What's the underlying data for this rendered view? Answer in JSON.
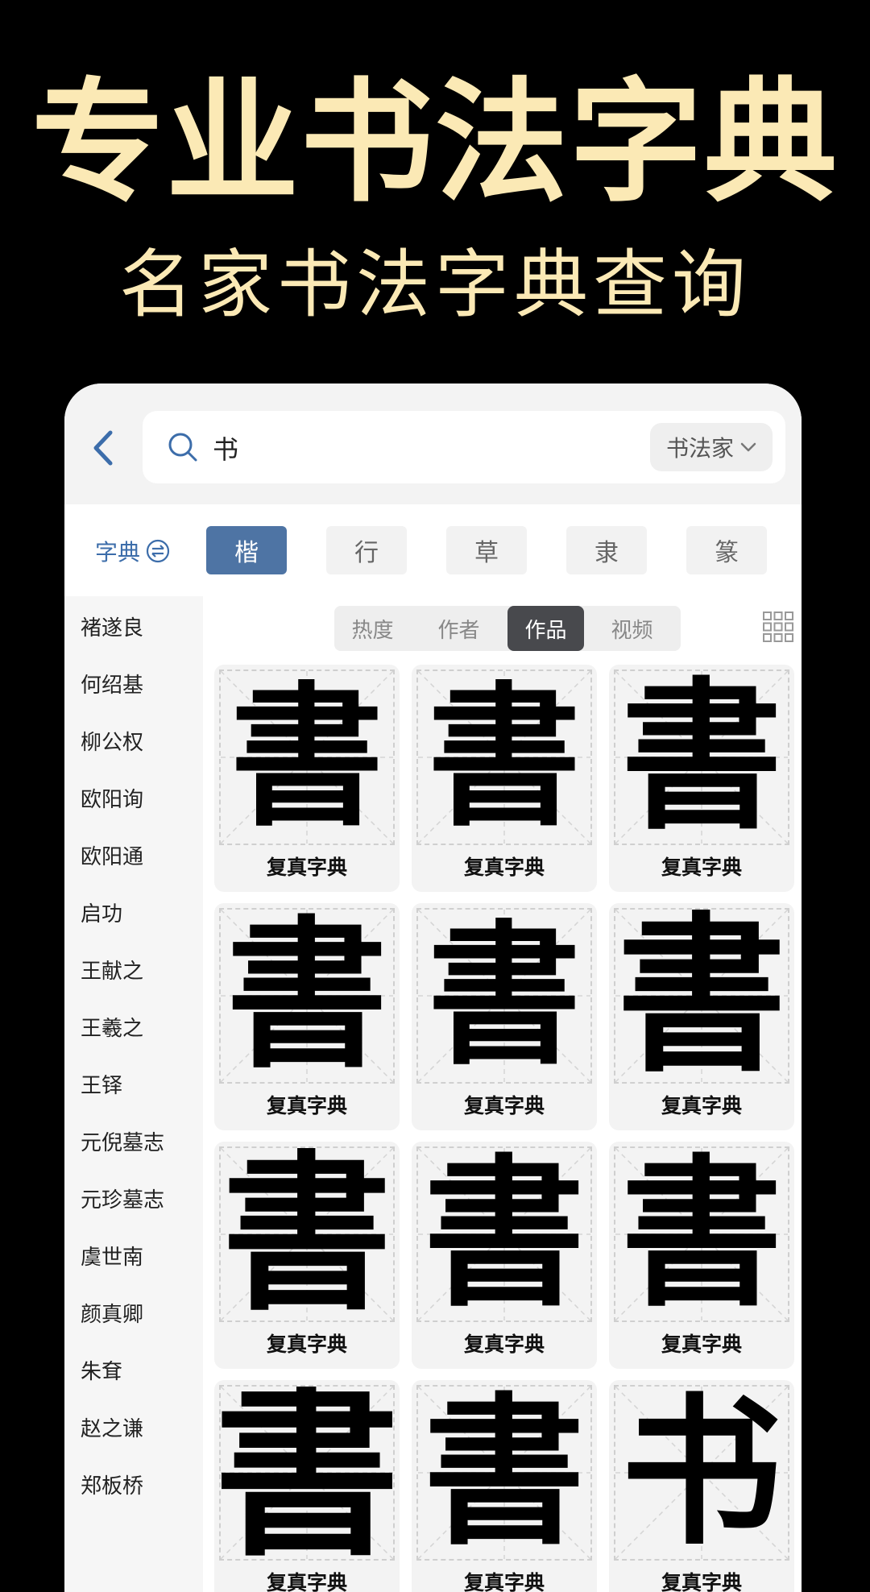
{
  "hero": {
    "title": "专业书法字典",
    "subtitle": "名家书法字典查询"
  },
  "search": {
    "query": "书",
    "scope_label": "书法家"
  },
  "dict_toggle_label": "字典",
  "style_tabs": [
    "楷",
    "行",
    "草",
    "隶",
    "篆"
  ],
  "active_style": "楷",
  "sort_tabs": [
    "热度",
    "作者",
    "作品",
    "视频"
  ],
  "active_sort": "作品",
  "sidebar": {
    "items": [
      "褚遂良",
      "何绍基",
      "柳公权",
      "欧阳询",
      "欧阳通",
      "启功",
      "王献之",
      "王羲之",
      "王铎",
      "元倪墓志",
      "元珍墓志",
      "虞世南",
      "颜真卿",
      "朱耷",
      "赵之谦",
      "郑板桥"
    ]
  },
  "results": [
    {
      "glyph": "書",
      "label": "复真字典"
    },
    {
      "glyph": "書",
      "label": "复真字典"
    },
    {
      "glyph": "書",
      "label": "复真字典"
    },
    {
      "glyph": "書",
      "label": "复真字典"
    },
    {
      "glyph": "書",
      "label": "复真字典"
    },
    {
      "glyph": "書",
      "label": "复真字典"
    },
    {
      "glyph": "書",
      "label": "复真字典"
    },
    {
      "glyph": "書",
      "label": "复真字典"
    },
    {
      "glyph": "書",
      "label": "复真字典"
    },
    {
      "glyph": "書",
      "label": "复真字典"
    },
    {
      "glyph": "書",
      "label": "复真字典"
    },
    {
      "glyph": "书",
      "label": "复真字典"
    }
  ],
  "colors": {
    "hero_text": "#FBE9B5",
    "accent_blue": "#4E74A4",
    "active_sort_bg": "#48494D"
  },
  "icons": {
    "back": "chevron-left-icon",
    "search": "search-icon",
    "dropdown": "chevron-down-icon",
    "toggle": "switch-icon",
    "grid": "grid-view-icon"
  }
}
